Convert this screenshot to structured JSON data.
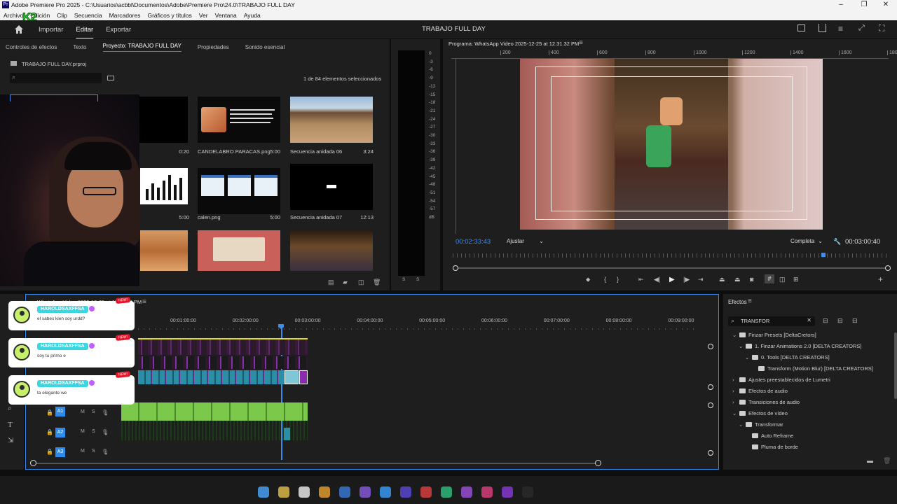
{
  "window": {
    "title": "Adobe Premiere Pro 2025 - C:\\Usuarios\\acbbl\\Documentos\\Adobe\\Premiere Pro\\24.0\\TRABAJO FULL DAY"
  },
  "menu": [
    "Archivo",
    "Edición",
    "Clip",
    "Secuencia",
    "Marcadores",
    "Gráficos y títulos",
    "Ver",
    "Ventana",
    "Ayuda"
  ],
  "appbar": {
    "tabs": [
      "Importar",
      "Editar",
      "Exportar"
    ],
    "active": "Editar",
    "project_title": "TRABAJO FULL DAY"
  },
  "project_panel": {
    "tabs": [
      "Controles de efectos",
      "Texto",
      "Proyecto: TRABAJO FULL DAY",
      "Propiedades",
      "Sonido esencial"
    ],
    "file": "TRABAJO FULL DAY.prproj",
    "selection_count": "1 de 84 elementos seleccionados",
    "items": [
      {
        "name": "",
        "duration": "0:20"
      },
      {
        "name": "CANDELABRO PARACAS.png",
        "duration": "5:00"
      },
      {
        "name": "Secuencia anidada 06",
        "duration": "3:24"
      },
      {
        "name": "",
        "duration": "5:00"
      },
      {
        "name": "calen.png",
        "duration": "5:00"
      },
      {
        "name": "Secuencia anidada 07",
        "duration": "12:13"
      }
    ]
  },
  "audio_meter": {
    "labels": [
      "0",
      "-3",
      "-6",
      "-9",
      "-12",
      "-15",
      "-18",
      "-21",
      "-24",
      "-27",
      "-30",
      "-33",
      "-36",
      "-39",
      "-42",
      "-45",
      "-48",
      "-51",
      "-54",
      "-57",
      "dB"
    ],
    "bottom": [
      "S",
      "S"
    ]
  },
  "program_monitor": {
    "title": "Programa: WhatsApp Video 2025-12-25 at 12.31.32 PM",
    "ruler": [
      "200",
      "400",
      "600",
      "800",
      "1000",
      "1200",
      "1400",
      "1600",
      "1800"
    ],
    "timecode": "00:02:33:43",
    "fit": "Ajustar",
    "quality": "Completa",
    "duration": "00:03:00:40"
  },
  "timeline": {
    "title": "WhatsApp Video 2025-12-25 at 12.31.32 PM",
    "ruler": [
      "00:01:00:00",
      "00:02:00:00",
      "00:03:00:00",
      "00:04:00:00",
      "00:05:00:00",
      "00:06:00:00",
      "00:07:00:00",
      "00:08:00:00",
      "00:09:00:00"
    ],
    "tracks": [
      {
        "name": "A1",
        "m": "M",
        "s": "S"
      },
      {
        "name": "A2",
        "m": "M",
        "s": "S"
      },
      {
        "name": "A3",
        "m": "M",
        "s": "S"
      }
    ]
  },
  "chat": [
    {
      "user": "HAROLDSAXFFSA",
      "message": "el sabes kien soy urdd?",
      "badge": "NEW!"
    },
    {
      "user": "HAROLDSAXFFSA",
      "message": "soy tu primo e",
      "badge": "NEW!"
    },
    {
      "user": "HAROLDSAXFFSA",
      "message": "ta elegante we",
      "badge": "NEW!"
    }
  ],
  "effects_panel": {
    "title": "Efectos",
    "search": "TRANSFOR",
    "tree": [
      "Finzar Presets [DeltaCretors]",
      "1. Finzar Animations 2.0  [DELTA CREATORS]",
      "0. Tools [DELTA CREATORS]",
      "Transform (Motion Blur) [DELTA CREATORS]",
      "Ajustes preestablecidos de Lumetri",
      "Efectos de audio",
      "Transiciones de audio",
      "Efectos de vídeo",
      "Transformar",
      "Auto Reframe",
      "Pluma de borde"
    ]
  },
  "overlay": {
    "logo": "K2"
  },
  "colors": {
    "accent_blue": "#2d8ceb",
    "playhead": "#3b8df0",
    "clip_video": "#2a8fa6",
    "clip_purple": "#8b2bb0",
    "clip_audio": "#7cc84a"
  }
}
